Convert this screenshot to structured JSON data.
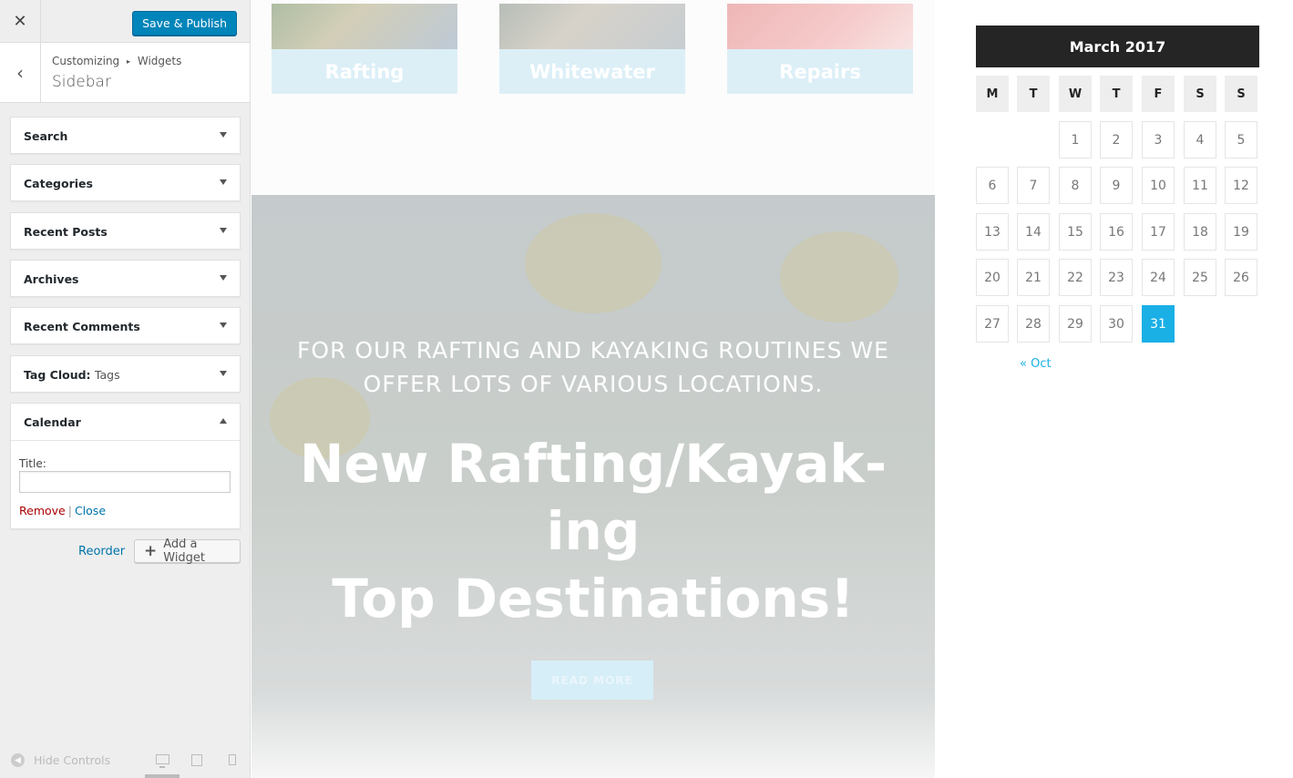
{
  "customizer": {
    "close_label": "✕",
    "publish_label": "Save & Publish",
    "back_label": "‹",
    "breadcrumb": {
      "root": "Customizing",
      "separator": "▸",
      "current": "Widgets"
    },
    "section_title": "Sidebar",
    "widgets": [
      {
        "title": "Search",
        "sub": ""
      },
      {
        "title": "Categories",
        "sub": ""
      },
      {
        "title": "Recent Posts",
        "sub": ""
      },
      {
        "title": "Archives",
        "sub": ""
      },
      {
        "title": "Recent Comments",
        "sub": ""
      },
      {
        "title": "Tag Cloud:",
        "sub": "Tags"
      },
      {
        "title": "Calendar",
        "sub": ""
      }
    ],
    "calendar_form": {
      "title_label": "Title:",
      "title_value": "",
      "remove_label": "Remove",
      "separator": "|",
      "close_label": "Close"
    },
    "reorder_label": "Reorder",
    "add_widget_label": "Add a Widget",
    "add_widget_icon": "+",
    "hide_controls_label": "Hide Controls"
  },
  "site": {
    "services": [
      "Rafting",
      "Whitewater",
      "Repairs"
    ],
    "hero": {
      "subtitle": "FOR OUR RAFTING AND KAYAKING ROUTINES WE OFFER LOTS OF VARIOUS LOCATIONS.",
      "title_line1": "New Rafting/Kayak-",
      "title_line2": "ing",
      "title_line3": "Top Destinations!",
      "button_label": "READ MORE"
    }
  },
  "calendar": {
    "caption": "March 2017",
    "weekdays": [
      "M",
      "T",
      "W",
      "T",
      "F",
      "S",
      "S"
    ],
    "days": [
      "1",
      "2",
      "3",
      "4",
      "5",
      "6",
      "7",
      "8",
      "9",
      "10",
      "11",
      "12",
      "13",
      "14",
      "15",
      "16",
      "17",
      "18",
      "19",
      "20",
      "21",
      "22",
      "23",
      "24",
      "25",
      "26",
      "27",
      "28",
      "29",
      "30",
      "31"
    ],
    "first_weekday_index": 2,
    "today": "31",
    "prev_link": "« Oct"
  },
  "colors": {
    "accent": "#1ab0e6",
    "publish": "#0085ba",
    "calendar_header": "#252525"
  }
}
